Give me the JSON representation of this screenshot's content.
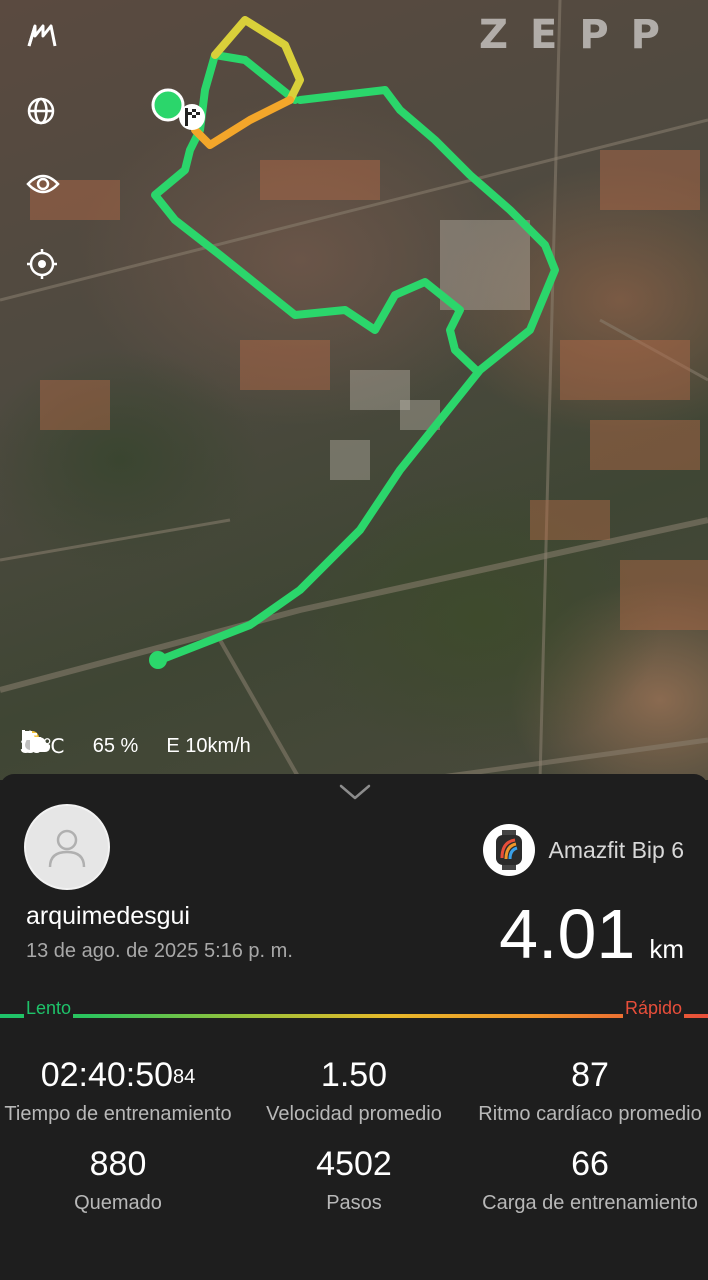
{
  "map": {
    "brand": "ZEPP",
    "tools": [
      "km-flag-icon",
      "globe-icon",
      "eye-icon",
      "locate-icon"
    ],
    "weather": {
      "temperature": "30℃",
      "humidity": "65 %",
      "wind": "E 10km/h"
    },
    "colors": {
      "route_slow": "#2bd66b",
      "route_mid": "#d9d03a",
      "route_fast": "#f3a62a"
    }
  },
  "panel": {
    "username": "arquimedesgui",
    "datetime": "13 de ago. de 2025 5:16 p. m.",
    "device": "Amazfit Bip 6",
    "distance": {
      "value": "4.01",
      "unit": "km"
    },
    "speed_scale": {
      "slow": "Lento",
      "fast": "Rápido"
    },
    "stats": [
      {
        "value": "02:40:50",
        "sup": "84",
        "label": "Tiempo de entrenamiento"
      },
      {
        "value": "1.50",
        "label": "Velocidad promedio"
      },
      {
        "value": "87",
        "label": "Ritmo cardíaco promedio"
      },
      {
        "value": "880",
        "label": "Quemado"
      },
      {
        "value": "4502",
        "label": "Pasos"
      },
      {
        "value": "66",
        "label": "Carga de entrenamiento"
      }
    ]
  }
}
